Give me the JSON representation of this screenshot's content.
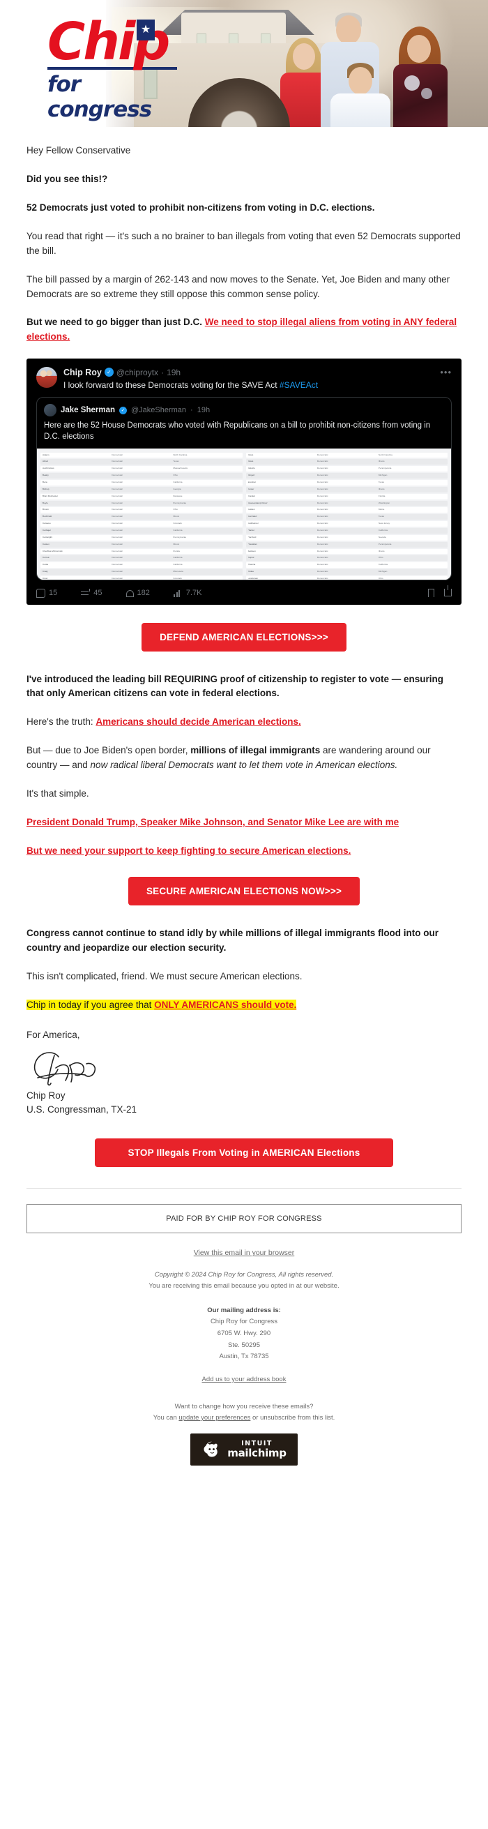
{
  "banner": {
    "logo_main": "Chip",
    "logo_sub": "for congress",
    "star_glyph": "★",
    "photo_alt": "chip-roy-family-photo"
  },
  "body": {
    "greeting": "Hey Fellow Conservative",
    "hook": "Did you see this!?",
    "headline": "52 Democrats just voted to prohibit non-citizens from voting in D.C. elections.",
    "para_read_that_right": "You read that right — it's such a no brainer to ban illegals from voting that even 52 Democrats supported the bill.",
    "para_margin": "The bill passed by a margin of 262-143 and now moves to the Senate. Yet, Joe Biden and many other Democrats are so extreme they still oppose this common sense policy.",
    "para_bigger_lead": "But we need to go bigger than just D.C. ",
    "para_bigger_link": "We need to stop illegal aliens from voting in ANY federal elections. ",
    "cta_defend": "DEFEND AMERICAN ELECTIONS>>>",
    "para_introduced": "I've introduced the leading bill REQUIRING proof of citizenship to register to vote — ensuring that only American citizens can vote in federal elections.",
    "truth_lead": "Here's the truth: ",
    "truth_link": "Americans should decide American elections.",
    "para_border_1": "But — due to Joe Biden's open border, ",
    "para_border_2": "millions of illegal immigrants",
    "para_border_3": " are wandering around our country — and ",
    "para_border_4": "now radical liberal Democrats want to let them vote in American elections.",
    "para_simple": "It's that simple.",
    "link_endorsers": "President Donald Trump, Speaker Mike Johnson, and Senator Mike Lee are with me",
    "link_support": "But we need your support to keep fighting to secure American elections.",
    "cta_secure": "SECURE AMERICAN ELECTIONS NOW>>>",
    "para_congress": "Congress cannot continue to stand idly by while millions of illegal immigrants flood into our country and jeopardize our election security.",
    "para_not_complicated": "This isn't complicated, friend. We must secure American elections.",
    "highlight_lead": "Chip in today if you agree that ",
    "highlight_link": "ONLY AMERICANS should vote.",
    "signoff": "For America,",
    "sign_name": "Chip Roy",
    "sign_title": "U.S. Congressman, TX-21",
    "cta_stop": "STOP Illegals From Voting in AMERICAN Elections"
  },
  "tweet": {
    "author_name": "Chip Roy",
    "author_handle": "@chiproytx",
    "time": "19h",
    "separator": "·",
    "more_glyph": "•••",
    "verified_glyph": "✓",
    "text_lead": "I look forward to these Democrats voting for the SAVE Act ",
    "text_hashtag": "#SAVEAct",
    "quoted": {
      "author_name": "Jake Sherman",
      "author_handle": "@JakeSherman",
      "time": "19h",
      "text": "Here are the 52 House Democrats who voted with Republicans on a bill to prohibit non-citizens from voting in D.C. elections",
      "screenshot_rows_left": [
        [
          "Adams",
          "Democratic",
          "North Carolina"
        ],
        [
          "Allred",
          "Democratic",
          "Texas"
        ],
        [
          "Auchincloss",
          "Democratic",
          "Massachusetts"
        ],
        [
          "Beatty",
          "Democratic",
          "Ohio"
        ],
        [
          "Bera",
          "Democratic",
          "California"
        ],
        [
          "Bishop",
          "Democratic",
          "Georgia"
        ],
        [
          "Blunt Rochester",
          "Democratic",
          "Delaware"
        ],
        [
          "Boyle",
          "Democratic",
          "Pennsylvania"
        ],
        [
          "Brown",
          "Democratic",
          "Ohio"
        ],
        [
          "Budzinski",
          "Democratic",
          "Illinois"
        ],
        [
          "Caraveo",
          "Democratic",
          "Colorado"
        ],
        [
          "Carbajal",
          "Democratic",
          "California"
        ],
        [
          "Cartwright",
          "Democratic",
          "Pennsylvania"
        ],
        [
          "Casten",
          "Democratic",
          "Illinois"
        ],
        [
          "Cherfilus-McCormick",
          "Democratic",
          "Florida"
        ],
        [
          "Correa",
          "Democratic",
          "California"
        ],
        [
          "Costa",
          "Democratic",
          "California"
        ],
        [
          "Craig",
          "Democratic",
          "Minnesota"
        ],
        [
          "Crow",
          "Democratic",
          "Colorado"
        ],
        [
          "Cuellar",
          "Democratic",
          "Texas"
        ]
      ],
      "screenshot_rows_right": [
        [
          "Davis",
          "Democratic",
          "North Carolina"
        ],
        [
          "Davis",
          "Democratic",
          "Illinois"
        ],
        [
          "Deluzio",
          "Democratic",
          "Pennsylvania"
        ],
        [
          "Dingell",
          "Democratic",
          "Michigan"
        ],
        [
          "Escobar",
          "Democratic",
          "Texas"
        ],
        [
          "Foster",
          "Democratic",
          "Illinois"
        ],
        [
          "Frankel",
          "Democratic",
          "Florida"
        ],
        [
          "Gluesenkamp Perez",
          "Democratic",
          "Washington"
        ],
        [
          "Golden",
          "Democratic",
          "Maine"
        ],
        [
          "Gonzalez",
          "Democratic",
          "Texas"
        ],
        [
          "Gottheimer",
          "Democratic",
          "New Jersey"
        ],
        [
          "Harder",
          "Democratic",
          "California"
        ],
        [
          "Horsford",
          "Democratic",
          "Nevada"
        ],
        [
          "Houlahan",
          "Democratic",
          "Pennsylvania"
        ],
        [
          "Jackson",
          "Democratic",
          "Illinois"
        ],
        [
          "Kaptur",
          "Democratic",
          "Ohio"
        ],
        [
          "Khanna",
          "Democratic",
          "California"
        ],
        [
          "Kildee",
          "Democratic",
          "Michigan"
        ],
        [
          "Landsman",
          "Democratic",
          "Ohio"
        ],
        [
          "Larsen",
          "Democratic",
          "Washington"
        ]
      ]
    },
    "stats": {
      "replies": "15",
      "retweets": "45",
      "likes": "182",
      "views": "7.7K"
    }
  },
  "footer": {
    "paid_for": "PAID FOR BY CHIP ROY FOR CONGRESS",
    "view_in_browser": "View this email in your browser",
    "copyright": "Copyright © 2024 Chip Roy for Congress, All rights reserved.",
    "why_receiving": "You are receiving this email because you opted in at our website.",
    "mailing_label": "Our mailing address is:",
    "addr_line1": "Chip Roy for Congress",
    "addr_line2": "6705 W. Hwy. 290",
    "addr_line3": "Ste. 50295",
    "addr_line4": "Austin, Tx 78735",
    "add_address_book": "Add us to your address book",
    "change_q": "Want to change how you receive these emails?",
    "prefs_lead": "You can ",
    "prefs_link": "update your preferences",
    "prefs_tail": " or unsubscribe from this list.",
    "mailchimp_intuit": "INTUIT",
    "mailchimp_name": "mailchimp"
  },
  "colors": {
    "brand_red": "#e4111f",
    "brand_navy": "#1b2f6e",
    "cta_red": "#e8232a",
    "link_red": "#e01b24",
    "highlight_yellow": "#fff200"
  }
}
